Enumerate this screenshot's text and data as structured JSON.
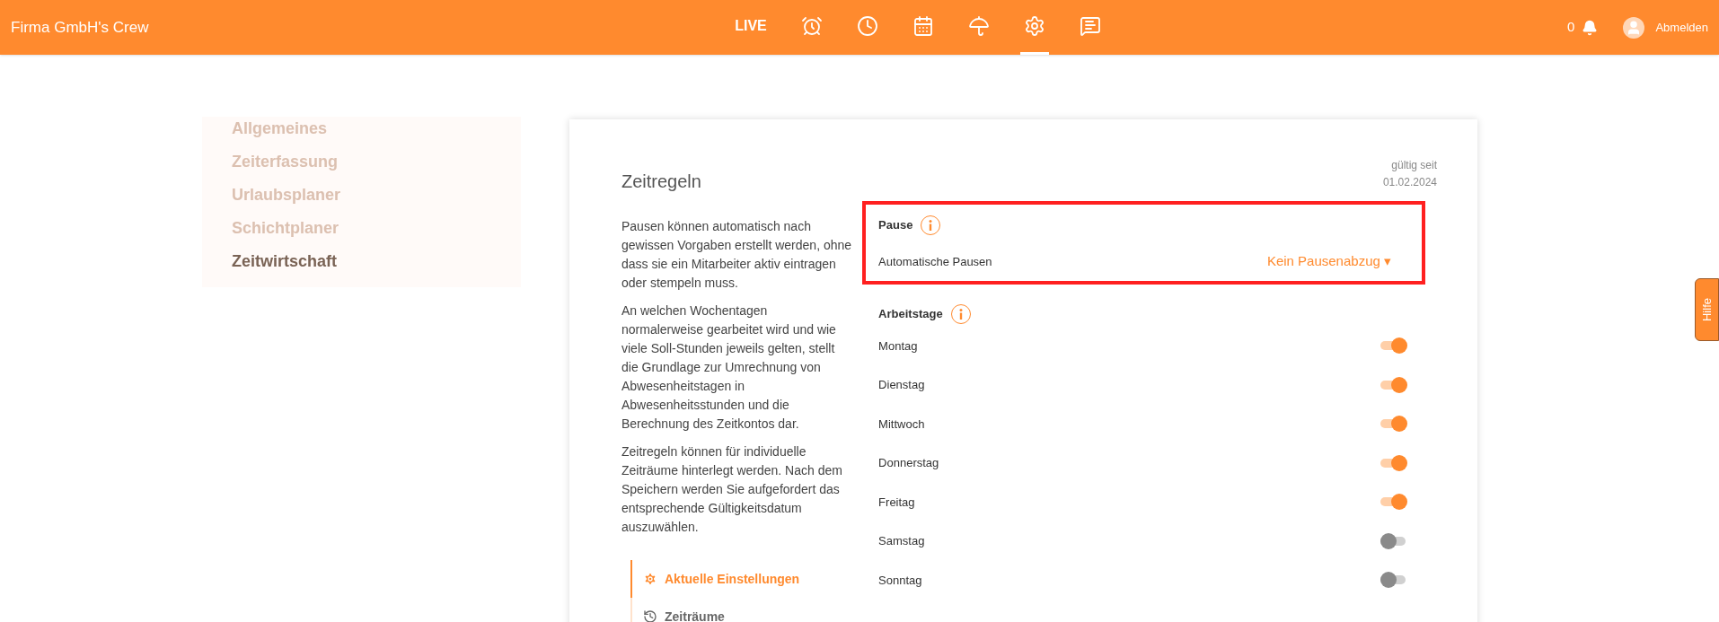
{
  "app_title": "Firma GmbH's Crew",
  "nav": [
    {
      "kind": "text",
      "label": "LIVE",
      "selected": false
    },
    {
      "kind": "icon",
      "selected": false
    },
    {
      "kind": "icon",
      "selected": false
    },
    {
      "kind": "icon",
      "selected": false
    },
    {
      "kind": "icon",
      "selected": false
    },
    {
      "kind": "icon",
      "selected": true
    },
    {
      "kind": "icon",
      "selected": false
    }
  ],
  "notifications": "0",
  "logout": "Abmelden",
  "sidebar": {
    "items": [
      {
        "label": "Allgemeines",
        "selected": false
      },
      {
        "label": "Zeiterfassung",
        "selected": false
      },
      {
        "label": "Urlaubsplaner",
        "selected": false
      },
      {
        "label": "Schichtplaner",
        "selected": false
      },
      {
        "label": "Zeitwirtschaft",
        "selected": true
      }
    ]
  },
  "card": {
    "title": "Zeitregeln",
    "valid_label": "gültig seit",
    "valid_date": "01.02.2024",
    "paragraphs": [
      "Pausen können automatisch nach gewissen Vorgaben erstellt werden, ohne dass sie ein Mitarbeiter aktiv eintragen oder stempeln muss.",
      "An welchen Wochentagen normalerweise gearbeitet wird und wie viele Soll-Stunden jeweils gelten, stellt die Grundlage zur Umrechnung von Abwesenheitstagen in Abwesenheitsstunden und die Berechnung des Zeitkontos dar.",
      "Zeitregeln können für individuelle Zeiträume hinterlegt werden. Nach dem Speichern werden Sie aufgefordert das entsprechende Gültigkeitsdatum auszuwählen."
    ],
    "subtabs": [
      {
        "label": "Aktuelle Einstellungen",
        "selected": true
      },
      {
        "label": "Zeiträume",
        "selected": false
      }
    ],
    "pause": {
      "title": "Pause",
      "highlighted": true,
      "label": "Automatische Pausen",
      "value": "Kein Pausenabzug ▾"
    },
    "workdays": {
      "title": "Arbeitstage",
      "days": [
        {
          "label": "Montag",
          "on": true
        },
        {
          "label": "Dienstag",
          "on": true
        },
        {
          "label": "Mittwoch",
          "on": true
        },
        {
          "label": "Donnerstag",
          "on": true
        },
        {
          "label": "Freitag",
          "on": true
        },
        {
          "label": "Samstag",
          "on": false
        },
        {
          "label": "Sonntag",
          "on": false
        }
      ]
    }
  },
  "help_tab": "Hilfe"
}
